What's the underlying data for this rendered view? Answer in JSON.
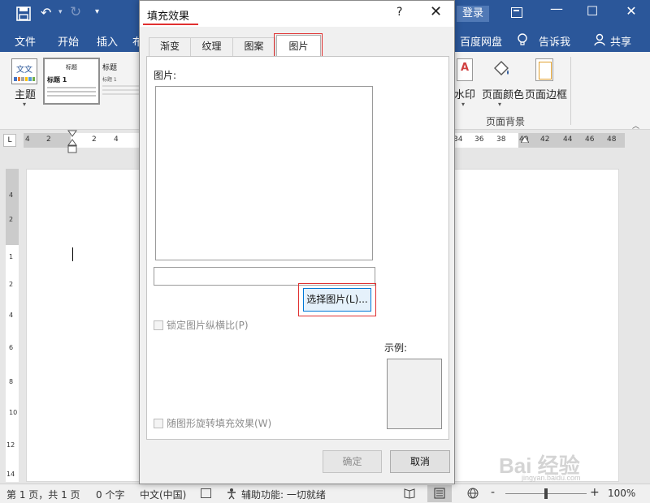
{
  "colors": {
    "brand": "#2b579a",
    "highlight": "#e03030",
    "focus": "#0078d7"
  },
  "titlebar": {
    "login_label": "登录"
  },
  "tabs": {
    "file": "文件",
    "home": "开始",
    "insert": "插入",
    "design": "布",
    "baidu": "百度网盘",
    "tellme": "告诉我",
    "share": "共享"
  },
  "ribbon": {
    "theme_label": "主题",
    "theme_icon_text": "文文",
    "style_thumb_1": {
      "title": "标题",
      "heading": "标题 1"
    },
    "style_thumb_2": {
      "title": "标题",
      "heading": "标题 1"
    },
    "watermark_label": "水印",
    "page_color_label": "页面颜色",
    "page_border_label": "页面边框",
    "group_label": "页面背景"
  },
  "ruler": {
    "left_numbers": [
      "4",
      "2"
    ],
    "mid_numbers": [
      "2",
      "4"
    ],
    "right_numbers": [
      "34",
      "36",
      "38",
      "40",
      "42",
      "44",
      "46",
      "48"
    ],
    "vertical_numbers": [
      "4",
      "2",
      "1",
      "2",
      "4",
      "6",
      "8",
      "10",
      "12",
      "14"
    ]
  },
  "statusbar": {
    "pages": "第 1 页，共 1 页",
    "words": "0 个字",
    "language": "中文(中国)",
    "accessibility": "辅助功能: 一切就绪",
    "zoom_minus": "-",
    "zoom_plus": "+",
    "zoom": "100%"
  },
  "dialog": {
    "title": "填充效果",
    "help": "?",
    "close": "✕",
    "tabs": [
      "渐变",
      "纹理",
      "图案",
      "图片"
    ],
    "active_tab": "图片",
    "picture_label": "图片:",
    "picture_name_value": "",
    "select_button": "选择图片(L)...",
    "lock_ratio": "锁定图片纵横比(P)",
    "rotate_fill": "随图形旋转填充效果(W)",
    "sample_label": "示例:",
    "ok": "确定",
    "cancel": "取消"
  },
  "watermark_overlay": {
    "text": "Bai 经验",
    "sub": "jingyan.baidu.com"
  }
}
